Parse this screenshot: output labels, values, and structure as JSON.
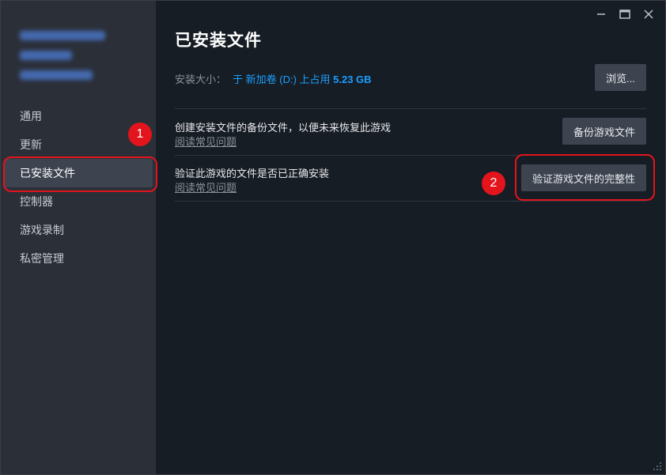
{
  "sidebar": {
    "items": [
      {
        "id": "general",
        "label": "通用"
      },
      {
        "id": "updates",
        "label": "更新"
      },
      {
        "id": "installed-files",
        "label": "已安装文件"
      },
      {
        "id": "controller",
        "label": "控制器"
      },
      {
        "id": "game-recording",
        "label": "游戏录制"
      },
      {
        "id": "privacy",
        "label": "私密管理"
      }
    ]
  },
  "main": {
    "title": "已安装文件",
    "install_size_label": "安装大小：",
    "install_location_prefix": "于 新加卷 (D:) 上占用",
    "install_size_value": "5.23 GB",
    "browse_label": "浏览...",
    "backup": {
      "title": "创建安装文件的备份文件，以便未来恢复此游戏",
      "faq": "阅读常见问题",
      "button": "备份游戏文件"
    },
    "verify": {
      "title": "验证此游戏的文件是否已正确安装",
      "faq": "阅读常见问题",
      "button": "验证游戏文件的完整性"
    }
  },
  "annotations": {
    "badge1": "1",
    "badge2": "2"
  },
  "colors": {
    "accent": "#1a9fff",
    "highlight": "#e3141c"
  }
}
